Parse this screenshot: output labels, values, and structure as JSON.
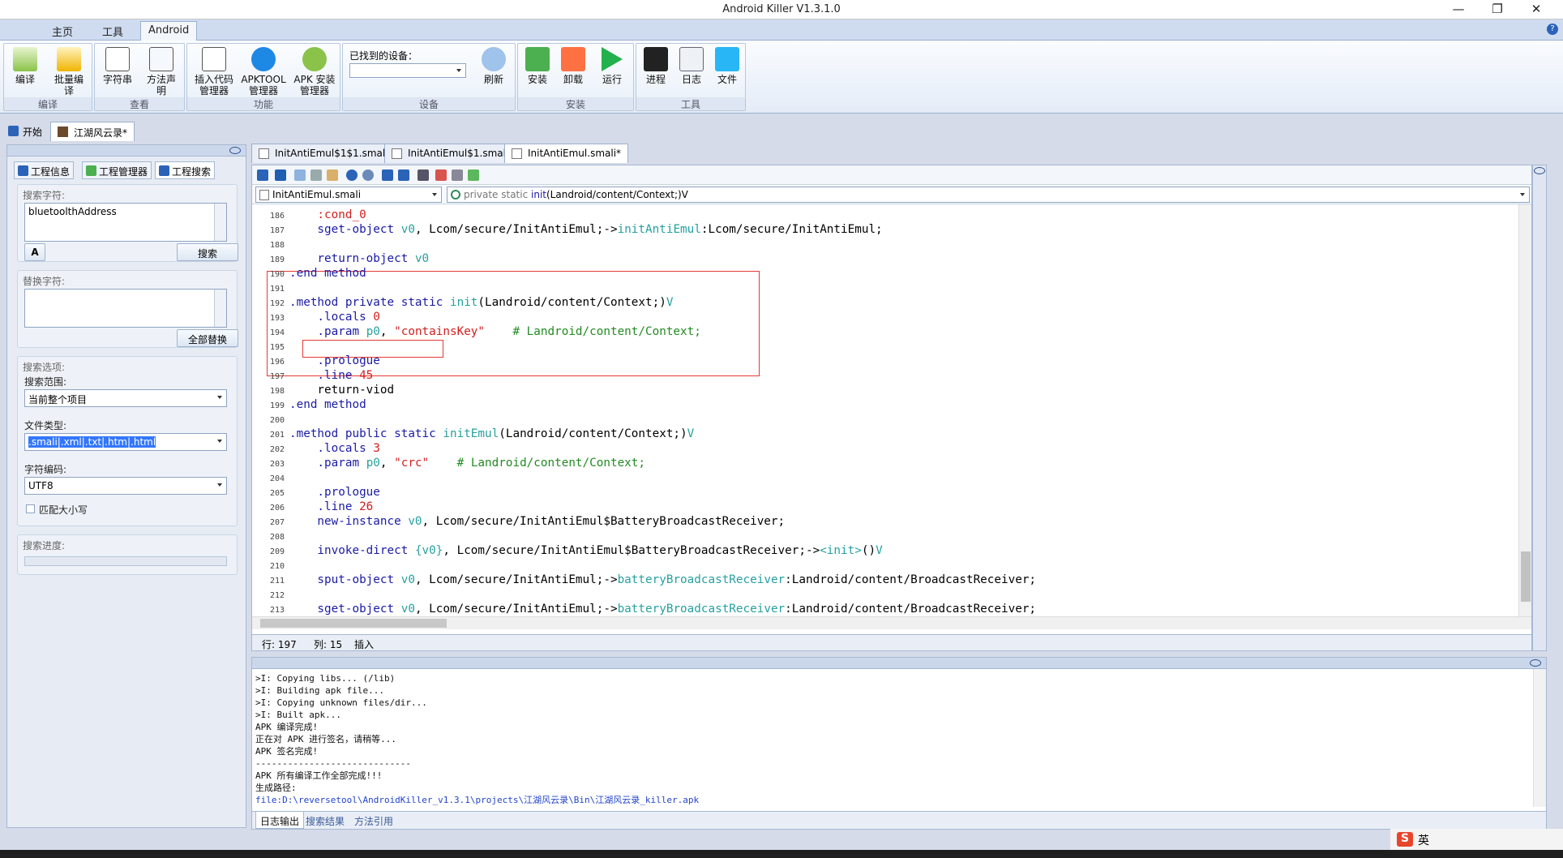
{
  "window": {
    "title": "Android Killer V1.3.1.0",
    "controls": {
      "minimize": "—",
      "restore": "❐",
      "close": "✕"
    }
  },
  "menu_tabs": [
    "主页",
    "工具",
    "Android"
  ],
  "help_icon": "?",
  "ribbon": {
    "groups": [
      {
        "label": "编译",
        "buttons": [
          "编译",
          "批量编\n译"
        ]
      },
      {
        "label": "查看",
        "buttons": [
          "字符串",
          "方法声\n明"
        ]
      },
      {
        "label": "功能",
        "buttons": [
          "插入代码\n管理器",
          "APKTOOL\n管理器",
          "APK 安装\n管理器"
        ]
      },
      {
        "label": "设备",
        "buttons": [
          "刷新"
        ],
        "device_label": "已找到的设备："
      },
      {
        "label": "安装",
        "buttons": [
          "安装",
          "卸载",
          "运行"
        ]
      },
      {
        "label": "工具",
        "buttons": [
          "进程",
          "日志",
          "文件"
        ]
      }
    ]
  },
  "doc_tabs": [
    {
      "label": "开始",
      "icon": "home-icon"
    },
    {
      "label": "江湖风云录*",
      "icon": "app-icon",
      "active": true
    }
  ],
  "editor_tabs": [
    {
      "label": "InitAntiEmul$1$1.smali"
    },
    {
      "label": "InitAntiEmul$1.smali"
    },
    {
      "label": "InitAntiEmul.smali*",
      "active": true
    }
  ],
  "left_panel": {
    "tabs": [
      "工程信息",
      "工程管理器",
      "工程搜索"
    ],
    "search": {
      "title": "搜索字符:",
      "value": "bluetoolthAddress",
      "button": "搜索",
      "case_icon": "A"
    },
    "replace": {
      "title": "替换字符:",
      "value": "",
      "button": "全部替换"
    },
    "options": {
      "title": "搜索选项:",
      "scope_label": "搜索范围:",
      "scope_value": "当前整个项目",
      "filetype_label": "文件类型:",
      "filetype_value": ".smali|.xml|.txt|.htm|.html",
      "encoding_label": "字符编码:",
      "encoding_value": "UTF8",
      "case_label": "匹配大小写"
    },
    "progress": {
      "title": "搜索进度:",
      "value": 0
    }
  },
  "editor": {
    "file_select": "InitAntiEmul.smali",
    "method_select": {
      "prefix": "private static ",
      "name": "init",
      "sig": "(Landroid/content/Context;)V"
    },
    "lines": [
      {
        "n": "186",
        "parts": [
          {
            "t": "    :cond_0",
            "c": "str"
          }
        ]
      },
      {
        "n": "187",
        "parts": [
          {
            "t": "    sget-object ",
            "c": "kw"
          },
          {
            "t": "v0",
            "c": "tl"
          },
          {
            "t": ", Lcom/secure/InitAntiEmul;->",
            "c": "cd"
          },
          {
            "t": "initAntiEmul",
            "c": "tl"
          },
          {
            "t": ":Lcom/secure/InitAntiEmul;",
            "c": "cd"
          }
        ]
      },
      {
        "n": "188",
        "parts": []
      },
      {
        "n": "189",
        "parts": [
          {
            "t": "    return-object ",
            "c": "kw"
          },
          {
            "t": "v0",
            "c": "tl"
          }
        ]
      },
      {
        "n": "190",
        "parts": [
          {
            "t": ".end method",
            "c": "kw"
          }
        ]
      },
      {
        "n": "191",
        "parts": []
      },
      {
        "n": "192",
        "parts": [
          {
            "t": ".method private static ",
            "c": "kw"
          },
          {
            "t": "init",
            "c": "tl"
          },
          {
            "t": "(Landroid/content/Context;)",
            "c": "cd"
          },
          {
            "t": "V",
            "c": "tl"
          }
        ]
      },
      {
        "n": "193",
        "parts": [
          {
            "t": "    .locals ",
            "c": "kw"
          },
          {
            "t": "0",
            "c": "str"
          }
        ]
      },
      {
        "n": "194",
        "parts": [
          {
            "t": "    .param ",
            "c": "kw"
          },
          {
            "t": "p0",
            "c": "tl"
          },
          {
            "t": ", ",
            "c": "cd"
          },
          {
            "t": "\"containsKey\"",
            "c": "str"
          },
          {
            "t": "    # Landroid/content/Context;",
            "c": "cm"
          }
        ]
      },
      {
        "n": "195",
        "parts": []
      },
      {
        "n": "196",
        "parts": [
          {
            "t": "    .prologue",
            "c": "kw"
          }
        ]
      },
      {
        "n": "197",
        "parts": [
          {
            "t": "    .line ",
            "c": "kw"
          },
          {
            "t": "45",
            "c": "str"
          }
        ]
      },
      {
        "n": "198",
        "parts": [
          {
            "t": "    return-viod",
            "c": "cd"
          }
        ]
      },
      {
        "n": "199",
        "parts": [
          {
            "t": ".end method",
            "c": "kw"
          }
        ]
      },
      {
        "n": "200",
        "parts": []
      },
      {
        "n": "201",
        "parts": [
          {
            "t": ".method public static ",
            "c": "kw"
          },
          {
            "t": "initEmul",
            "c": "tl"
          },
          {
            "t": "(Landroid/content/Context;)",
            "c": "cd"
          },
          {
            "t": "V",
            "c": "tl"
          }
        ]
      },
      {
        "n": "202",
        "parts": [
          {
            "t": "    .locals ",
            "c": "kw"
          },
          {
            "t": "3",
            "c": "str"
          }
        ]
      },
      {
        "n": "203",
        "parts": [
          {
            "t": "    .param ",
            "c": "kw"
          },
          {
            "t": "p0",
            "c": "tl"
          },
          {
            "t": ", ",
            "c": "cd"
          },
          {
            "t": "\"crc\"",
            "c": "str"
          },
          {
            "t": "    # Landroid/content/Context;",
            "c": "cm"
          }
        ]
      },
      {
        "n": "204",
        "parts": []
      },
      {
        "n": "205",
        "parts": [
          {
            "t": "    .prologue",
            "c": "kw"
          }
        ]
      },
      {
        "n": "206",
        "parts": [
          {
            "t": "    .line ",
            "c": "kw"
          },
          {
            "t": "26",
            "c": "str"
          }
        ]
      },
      {
        "n": "207",
        "parts": [
          {
            "t": "    new-instance ",
            "c": "kw"
          },
          {
            "t": "v0",
            "c": "tl"
          },
          {
            "t": ", Lcom/secure/InitAntiEmul$BatteryBroadcastReceiver;",
            "c": "cd"
          }
        ]
      },
      {
        "n": "208",
        "parts": []
      },
      {
        "n": "209",
        "parts": [
          {
            "t": "    invoke-direct ",
            "c": "kw"
          },
          {
            "t": "{v0}",
            "c": "tl"
          },
          {
            "t": ", Lcom/secure/InitAntiEmul$BatteryBroadcastReceiver;->",
            "c": "cd"
          },
          {
            "t": "<init>",
            "c": "tl"
          },
          {
            "t": "()",
            "c": "cd"
          },
          {
            "t": "V",
            "c": "tl"
          }
        ]
      },
      {
        "n": "210",
        "parts": []
      },
      {
        "n": "211",
        "parts": [
          {
            "t": "    sput-object ",
            "c": "kw"
          },
          {
            "t": "v0",
            "c": "tl"
          },
          {
            "t": ", Lcom/secure/InitAntiEmul;->",
            "c": "cd"
          },
          {
            "t": "batteryBroadcastReceiver",
            "c": "tl"
          },
          {
            "t": ":Landroid/content/BroadcastReceiver;",
            "c": "cd"
          }
        ]
      },
      {
        "n": "212",
        "parts": []
      },
      {
        "n": "213",
        "parts": [
          {
            "t": "    sget-object ",
            "c": "kw"
          },
          {
            "t": "v0",
            "c": "tl"
          },
          {
            "t": ", Lcom/secure/InitAntiEmul;->",
            "c": "cd"
          },
          {
            "t": "batteryBroadcastReceiver",
            "c": "tl"
          },
          {
            "t": ":Landroid/content/BroadcastReceiver;",
            "c": "cd"
          }
        ]
      }
    ]
  },
  "status": {
    "row": "行: 197",
    "col": "列: 15",
    "mode": "插入"
  },
  "log": {
    "lines": [
      ">I: Copying libs... (/lib)",
      ">I: Building apk file...",
      ">I: Copying unknown files/dir...",
      ">I: Built apk...",
      "APK 编译完成!",
      "正在对 APK 进行签名，请稍等...",
      "APK 签名完成!",
      "-----------------------------",
      "APK 所有编译工作全部完成!!!",
      "生成路径:"
    ],
    "path": "file:D:\\reversetool\\AndroidKiller_v1.3.1\\projects\\江湖风云录\\Bin\\江湖风云录_killer.apk",
    "tabs": [
      "日志输出",
      "搜索结果",
      "方法引用"
    ]
  },
  "tray": {
    "ime": "S",
    "lang": "英"
  },
  "colors": {
    "ribbon_bg": "#e4ecf7",
    "accent_blue": "#2a63b8",
    "highlight_box": "#e53935"
  }
}
